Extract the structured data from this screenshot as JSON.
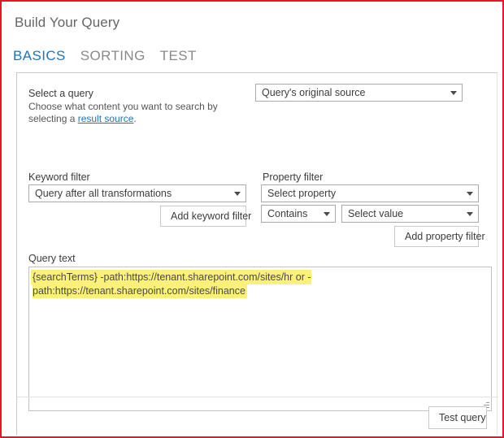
{
  "dialog": {
    "title": "Build Your Query"
  },
  "tabs": [
    {
      "label": "BASICS",
      "active": true
    },
    {
      "label": "SORTING",
      "active": false
    },
    {
      "label": "TEST",
      "active": false
    }
  ],
  "select_a_query": {
    "label": "Select a query",
    "help_prefix": "Choose what content you want to search by selecting a ",
    "help_link": "result source",
    "help_suffix": ".",
    "dropdown_value": "Query's original source"
  },
  "keyword_filter": {
    "label": "Keyword filter",
    "dropdown_value": "Query after all transformations",
    "add_button": "Add keyword filter"
  },
  "property_filter": {
    "label": "Property filter",
    "property_value": "Select property",
    "operator_value": "Contains",
    "value_value": "Select value",
    "add_button": "Add property filter"
  },
  "query_text": {
    "label": "Query text",
    "value": "{searchTerms} -path:https://tenant.sharepoint.com/sites/hr or -path:https://tenant.sharepoint.com/sites/finance"
  },
  "footer": {
    "test_button": "Test query"
  },
  "colors": {
    "accent": "#1f72c4",
    "title_gray": "#666666",
    "tab_inactive": "#8a8a8a",
    "highlight": "#fbf07a",
    "border_red": "#e8152a",
    "control_border": "#aaaaaa"
  },
  "icons": {
    "dropdown": "chevron-down-icon",
    "resize": "resize-grip-icon"
  }
}
